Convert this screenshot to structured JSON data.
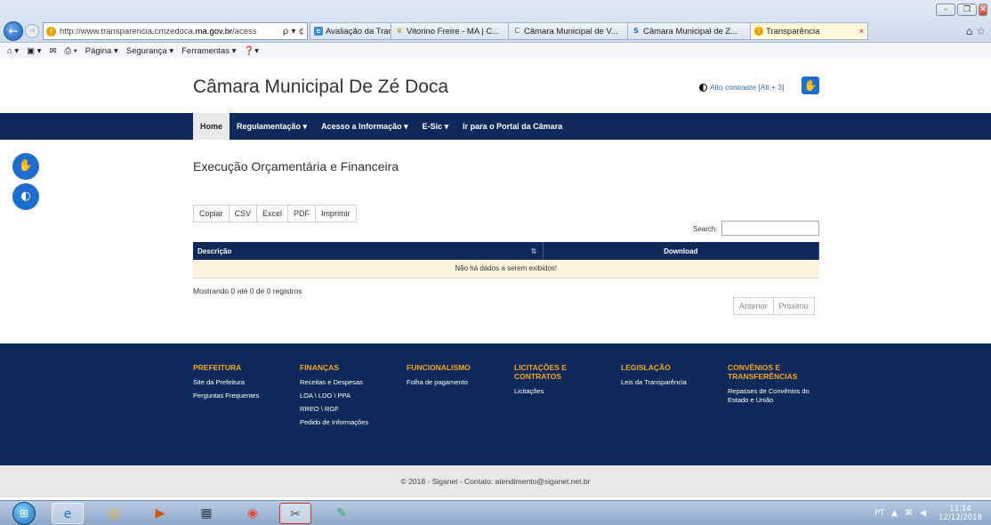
{
  "browser": {
    "url_prefix": "http://www.transparencia.cmzedoca.",
    "url_domain": "ma.gov.br",
    "url_suffix": "/acess",
    "address_icons": "ρ ▾ ¢",
    "tabs": [
      {
        "label": "Avaliação da Transparê...",
        "icon": "ie-icon"
      },
      {
        "label": "Vitorino Freire - MA | C...",
        "icon": "crest-icon"
      },
      {
        "label": "Câmara Municipal de V...",
        "icon": "c-logo-icon"
      },
      {
        "label": "Câmara Municipal de Z...",
        "icon": "s-logo-icon"
      },
      {
        "label": "Transparência",
        "icon": "info-icon",
        "close": "×"
      }
    ],
    "command_bar": [
      "Página ▾",
      "Segurança ▾",
      "Ferramentas ▾"
    ],
    "window_controls": [
      "–",
      "❐",
      "✕"
    ]
  },
  "site": {
    "title": "Câmara Municipal De Zé Doca",
    "contrast_label": "Alto contraste [Alt + 3]",
    "nav": [
      {
        "label": "Home"
      },
      {
        "label": "Regulamentação ▾"
      },
      {
        "label": "Acesso a Informação ▾"
      },
      {
        "label": "E-Sic ▾"
      },
      {
        "label": "Ir para o Portal da Câmara"
      }
    ]
  },
  "main": {
    "heading": "Execução Orçamentária e Financeira",
    "export_buttons": [
      "Copiar",
      "CSV",
      "Excel",
      "PDF",
      "Imprimir"
    ],
    "search_label": "Search:",
    "search_value": "",
    "table": {
      "columns": [
        "Descrição",
        "Download"
      ],
      "empty_message": "Não há dados a serem exibidos!"
    },
    "info": "Mostrando 0 até 0 de 0 registros",
    "pager": {
      "prev": "Anterior",
      "next": "Próximo"
    }
  },
  "footer": {
    "columns": [
      {
        "heading": "PREFEITURA",
        "links": [
          "Site da Prefeitura",
          "Perguntas Frequentes"
        ]
      },
      {
        "heading": "FINANÇAS",
        "links": [
          "Receitas e Despesas",
          "LOA \\ LDO \\ PPA",
          "RREO \\ RGF",
          "Pedido de Informações"
        ]
      },
      {
        "heading": "FUNCIONALISMO",
        "links": [
          "Folha de pagamento"
        ]
      },
      {
        "heading": "LICITAÇÕES E CONTRATOS",
        "links": [
          "Licitações"
        ]
      },
      {
        "heading": "LEGISLAÇÃO",
        "links": [
          "Leis da Transparência"
        ]
      },
      {
        "heading": "CONVÊNIOS E TRANSFERÊNCIAS",
        "links": [
          "Repasses de Convênios do Estado e União"
        ]
      }
    ],
    "copyright": "© 2018 - Siganet - Contato: atendimento@siganet.net.br"
  },
  "taskbar": {
    "lang": "PT",
    "time": "11:14",
    "date": "12/12/2018"
  },
  "colors": {
    "navy": "#0e2a5a",
    "accent_orange": "#f5a623",
    "link_blue": "#1e6ed0"
  }
}
